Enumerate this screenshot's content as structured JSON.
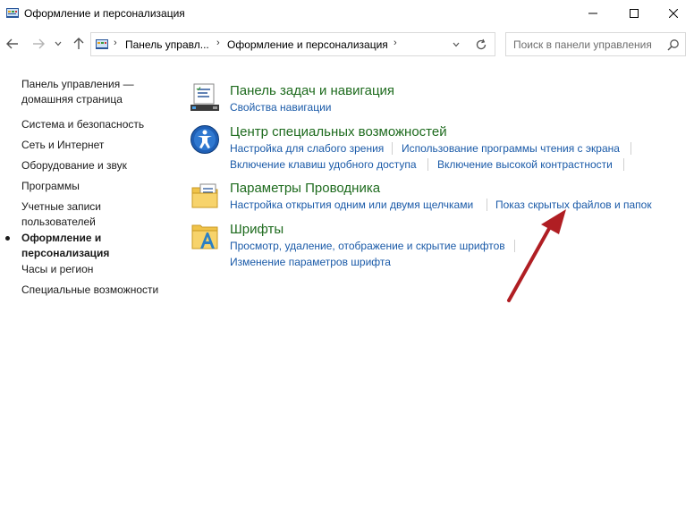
{
  "window": {
    "title": "Оформление и персонализация"
  },
  "address_bar": {
    "crumbs": [
      "Панель управл...",
      "Оформление и персонализация"
    ],
    "search_placeholder": "Поиск в панели управления"
  },
  "sidebar": {
    "items": [
      {
        "label": "Панель управления — домашняя страница",
        "line1": "Панель управления —",
        "line2": "домашняя страница",
        "active": false
      },
      {
        "label": "Система и безопасность",
        "active": false
      },
      {
        "label": "Сеть и Интернет",
        "active": false
      },
      {
        "label": "Оборудование и звук",
        "active": false
      },
      {
        "label": "Программы",
        "active": false
      },
      {
        "label": "Учетные записи пользователей",
        "line1": "Учетные записи",
        "line2": "пользователей",
        "active": false
      },
      {
        "label": "Оформление и персонализация",
        "line1": "Оформление и",
        "line2": "персонализация",
        "active": true
      },
      {
        "label": "Часы и регион",
        "active": false
      },
      {
        "label": "Специальные возможности",
        "active": false
      }
    ]
  },
  "categories": [
    {
      "title": "Панель задач и навигация",
      "icon": "taskbar-icon",
      "links": [
        "Свойства навигации"
      ]
    },
    {
      "title": "Центр специальных возможностей",
      "icon": "accessibility-icon",
      "links": [
        "Настройка для слабого зрения",
        "Использование программы чтения с экрана",
        "Включение клавиш удобного доступа",
        "Включение высокой контрастности"
      ]
    },
    {
      "title": "Параметры Проводника",
      "icon": "folder-options-icon",
      "links": [
        "Настройка открытия одним или двумя щелчками",
        "Показ скрытых файлов и папок"
      ]
    },
    {
      "title": "Шрифты",
      "icon": "fonts-folder-icon",
      "links": [
        "Просмотр, удаление, отображение и скрытие шрифтов",
        "Изменение параметров шрифта"
      ]
    }
  ],
  "colors": {
    "category_title": "#1e6b1e",
    "link": "#1a5aa8",
    "annotation_arrow": "#b01e23"
  }
}
